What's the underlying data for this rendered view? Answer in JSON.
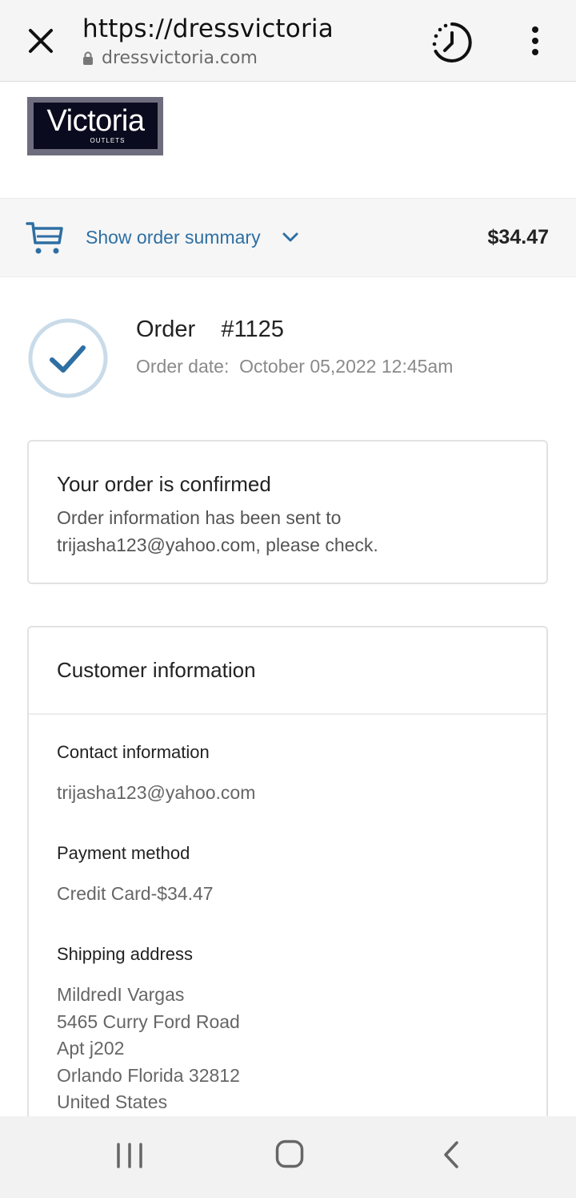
{
  "browser": {
    "title": "https://dressvictoria",
    "domain": "dressvictoria.com"
  },
  "logo": {
    "main": "Victoria",
    "sub": "OUTLETS"
  },
  "summary": {
    "label": "Show order summary",
    "total": "$34.47"
  },
  "order": {
    "title": "Order    #1125",
    "date_label": "Order date:",
    "date_value": "October 05,2022 12:45am"
  },
  "confirmation": {
    "title": "Your order is confirmed",
    "message": "Order information has been sent to trijasha123@yahoo.com, please check."
  },
  "customer": {
    "title": "Customer information",
    "contact_label": "Contact information",
    "contact_value": "trijasha123@yahoo.com",
    "payment_label": "Payment method",
    "payment_value": "Credit Card-$34.47",
    "shipping_label": "Shipping address",
    "shipping_lines": [
      "MildredI Vargas",
      "5465 Curry Ford Road",
      "Apt j202",
      "Orlando Florida 32812",
      "United States"
    ]
  },
  "colors": {
    "link": "#2e6fa3",
    "check": "#2e6fa3",
    "check_ring": "#c9dbe9"
  }
}
